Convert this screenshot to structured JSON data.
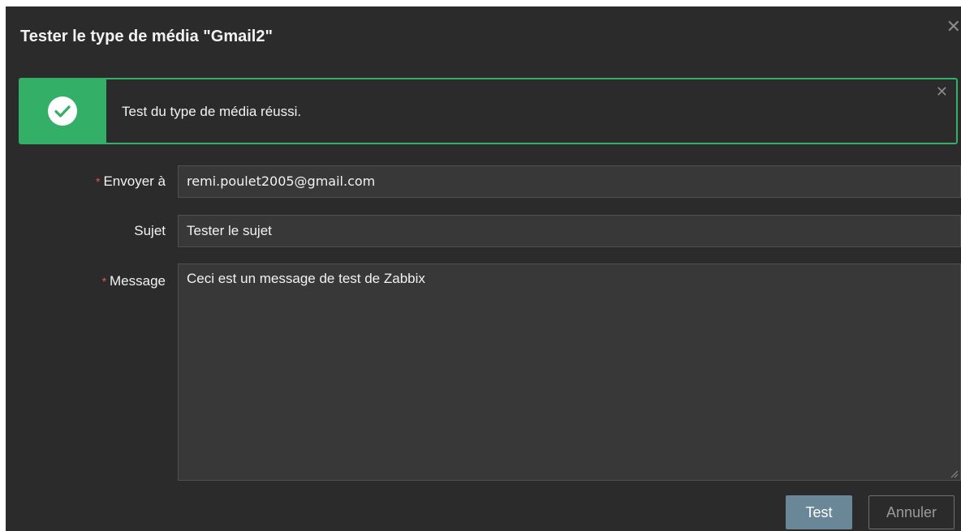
{
  "dialog": {
    "title": "Tester le type de média \"Gmail2\"",
    "close_icon": "close-icon"
  },
  "alert": {
    "message": "Test du type de média réussi.",
    "icon": "check-circle-icon",
    "close_icon": "close-icon",
    "color": "#34af67"
  },
  "form": {
    "send_to": {
      "label": "Envoyer à",
      "required_mark": "*",
      "value": "remi.poulet2005@gmail.com"
    },
    "subject": {
      "label": "Sujet",
      "value": "Tester le sujet"
    },
    "message": {
      "label": "Message",
      "required_mark": "*",
      "value": "Ceci est un message de test de Zabbix"
    }
  },
  "buttons": {
    "test_label": "Test",
    "cancel_label": "Annuler"
  }
}
